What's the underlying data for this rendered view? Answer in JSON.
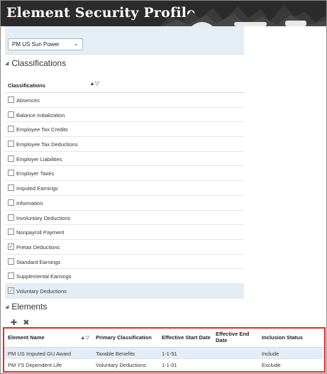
{
  "header": {
    "title": "Element Security Profile"
  },
  "security_profile": {
    "selected": "PM US Sun Power"
  },
  "classifications_section": {
    "title": "Classifications",
    "column_header": "Classifications",
    "items": [
      {
        "label": "Absences",
        "checked": false
      },
      {
        "label": "Balance Initialization",
        "checked": false
      },
      {
        "label": "Employee Tax Credits",
        "checked": false
      },
      {
        "label": "Employee Tax Deductions",
        "checked": false
      },
      {
        "label": "Employer Liabilities",
        "checked": false
      },
      {
        "label": "Employer Taxes",
        "checked": false
      },
      {
        "label": "Imputed Earnings",
        "checked": false
      },
      {
        "label": "Information",
        "checked": false
      },
      {
        "label": "Involuntary Deductions",
        "checked": false
      },
      {
        "label": "Nonpayroll Payment",
        "checked": false
      },
      {
        "label": "Pretax Deductions",
        "checked": true
      },
      {
        "label": "Standard Earnings",
        "checked": false
      },
      {
        "label": "Supplemental Earnings",
        "checked": false
      },
      {
        "label": "Voluntary Deductions",
        "checked": true
      }
    ]
  },
  "elements_section": {
    "title": "Elements",
    "columns": [
      "Element Name",
      "Primary Classification",
      "Effective Start Date",
      "Effective End Date",
      "Inclusion Status"
    ],
    "rows": [
      [
        "PM US Imputed GU Award",
        "Taxable Benefits",
        "1-1-51",
        "",
        "Include"
      ],
      [
        "PM YS Dependent Life",
        "Voluntary Deductions",
        "1-1-01",
        "",
        "Exclude"
      ]
    ]
  },
  "colors": {
    "header_bg": "#2b2b2b",
    "highlight_border": "#d93025",
    "selected_row": "#e3edf5"
  }
}
